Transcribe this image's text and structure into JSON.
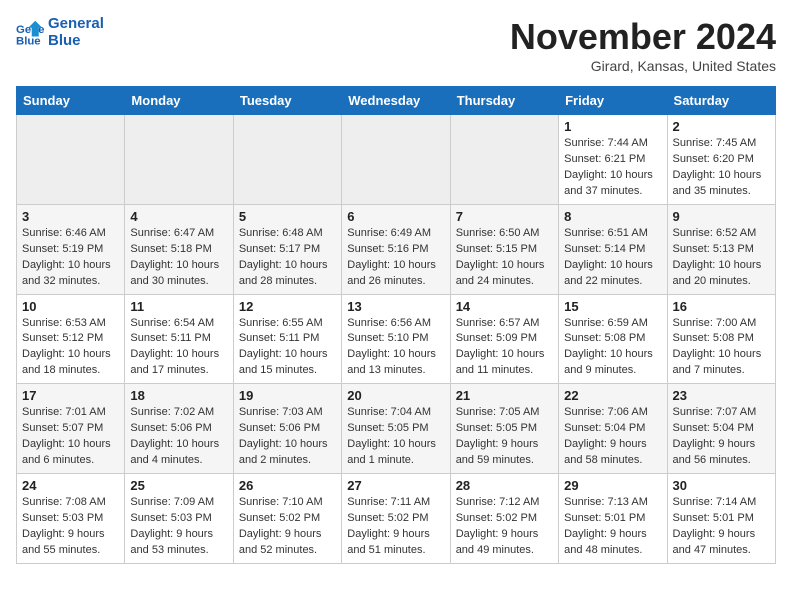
{
  "header": {
    "logo_line1": "General",
    "logo_line2": "Blue",
    "month": "November 2024",
    "location": "Girard, Kansas, United States"
  },
  "days_of_week": [
    "Sunday",
    "Monday",
    "Tuesday",
    "Wednesday",
    "Thursday",
    "Friday",
    "Saturday"
  ],
  "weeks": [
    [
      {
        "day": "",
        "empty": true
      },
      {
        "day": "",
        "empty": true
      },
      {
        "day": "",
        "empty": true
      },
      {
        "day": "",
        "empty": true
      },
      {
        "day": "",
        "empty": true
      },
      {
        "day": "1",
        "rise": "Sunrise: 7:44 AM",
        "set": "Sunset: 6:21 PM",
        "daylight": "Daylight: 10 hours and 37 minutes."
      },
      {
        "day": "2",
        "rise": "Sunrise: 7:45 AM",
        "set": "Sunset: 6:20 PM",
        "daylight": "Daylight: 10 hours and 35 minutes."
      }
    ],
    [
      {
        "day": "3",
        "rise": "Sunrise: 6:46 AM",
        "set": "Sunset: 5:19 PM",
        "daylight": "Daylight: 10 hours and 32 minutes."
      },
      {
        "day": "4",
        "rise": "Sunrise: 6:47 AM",
        "set": "Sunset: 5:18 PM",
        "daylight": "Daylight: 10 hours and 30 minutes."
      },
      {
        "day": "5",
        "rise": "Sunrise: 6:48 AM",
        "set": "Sunset: 5:17 PM",
        "daylight": "Daylight: 10 hours and 28 minutes."
      },
      {
        "day": "6",
        "rise": "Sunrise: 6:49 AM",
        "set": "Sunset: 5:16 PM",
        "daylight": "Daylight: 10 hours and 26 minutes."
      },
      {
        "day": "7",
        "rise": "Sunrise: 6:50 AM",
        "set": "Sunset: 5:15 PM",
        "daylight": "Daylight: 10 hours and 24 minutes."
      },
      {
        "day": "8",
        "rise": "Sunrise: 6:51 AM",
        "set": "Sunset: 5:14 PM",
        "daylight": "Daylight: 10 hours and 22 minutes."
      },
      {
        "day": "9",
        "rise": "Sunrise: 6:52 AM",
        "set": "Sunset: 5:13 PM",
        "daylight": "Daylight: 10 hours and 20 minutes."
      }
    ],
    [
      {
        "day": "10",
        "rise": "Sunrise: 6:53 AM",
        "set": "Sunset: 5:12 PM",
        "daylight": "Daylight: 10 hours and 18 minutes."
      },
      {
        "day": "11",
        "rise": "Sunrise: 6:54 AM",
        "set": "Sunset: 5:11 PM",
        "daylight": "Daylight: 10 hours and 17 minutes."
      },
      {
        "day": "12",
        "rise": "Sunrise: 6:55 AM",
        "set": "Sunset: 5:11 PM",
        "daylight": "Daylight: 10 hours and 15 minutes."
      },
      {
        "day": "13",
        "rise": "Sunrise: 6:56 AM",
        "set": "Sunset: 5:10 PM",
        "daylight": "Daylight: 10 hours and 13 minutes."
      },
      {
        "day": "14",
        "rise": "Sunrise: 6:57 AM",
        "set": "Sunset: 5:09 PM",
        "daylight": "Daylight: 10 hours and 11 minutes."
      },
      {
        "day": "15",
        "rise": "Sunrise: 6:59 AM",
        "set": "Sunset: 5:08 PM",
        "daylight": "Daylight: 10 hours and 9 minutes."
      },
      {
        "day": "16",
        "rise": "Sunrise: 7:00 AM",
        "set": "Sunset: 5:08 PM",
        "daylight": "Daylight: 10 hours and 7 minutes."
      }
    ],
    [
      {
        "day": "17",
        "rise": "Sunrise: 7:01 AM",
        "set": "Sunset: 5:07 PM",
        "daylight": "Daylight: 10 hours and 6 minutes."
      },
      {
        "day": "18",
        "rise": "Sunrise: 7:02 AM",
        "set": "Sunset: 5:06 PM",
        "daylight": "Daylight: 10 hours and 4 minutes."
      },
      {
        "day": "19",
        "rise": "Sunrise: 7:03 AM",
        "set": "Sunset: 5:06 PM",
        "daylight": "Daylight: 10 hours and 2 minutes."
      },
      {
        "day": "20",
        "rise": "Sunrise: 7:04 AM",
        "set": "Sunset: 5:05 PM",
        "daylight": "Daylight: 10 hours and 1 minute."
      },
      {
        "day": "21",
        "rise": "Sunrise: 7:05 AM",
        "set": "Sunset: 5:05 PM",
        "daylight": "Daylight: 9 hours and 59 minutes."
      },
      {
        "day": "22",
        "rise": "Sunrise: 7:06 AM",
        "set": "Sunset: 5:04 PM",
        "daylight": "Daylight: 9 hours and 58 minutes."
      },
      {
        "day": "23",
        "rise": "Sunrise: 7:07 AM",
        "set": "Sunset: 5:04 PM",
        "daylight": "Daylight: 9 hours and 56 minutes."
      }
    ],
    [
      {
        "day": "24",
        "rise": "Sunrise: 7:08 AM",
        "set": "Sunset: 5:03 PM",
        "daylight": "Daylight: 9 hours and 55 minutes."
      },
      {
        "day": "25",
        "rise": "Sunrise: 7:09 AM",
        "set": "Sunset: 5:03 PM",
        "daylight": "Daylight: 9 hours and 53 minutes."
      },
      {
        "day": "26",
        "rise": "Sunrise: 7:10 AM",
        "set": "Sunset: 5:02 PM",
        "daylight": "Daylight: 9 hours and 52 minutes."
      },
      {
        "day": "27",
        "rise": "Sunrise: 7:11 AM",
        "set": "Sunset: 5:02 PM",
        "daylight": "Daylight: 9 hours and 51 minutes."
      },
      {
        "day": "28",
        "rise": "Sunrise: 7:12 AM",
        "set": "Sunset: 5:02 PM",
        "daylight": "Daylight: 9 hours and 49 minutes."
      },
      {
        "day": "29",
        "rise": "Sunrise: 7:13 AM",
        "set": "Sunset: 5:01 PM",
        "daylight": "Daylight: 9 hours and 48 minutes."
      },
      {
        "day": "30",
        "rise": "Sunrise: 7:14 AM",
        "set": "Sunset: 5:01 PM",
        "daylight": "Daylight: 9 hours and 47 minutes."
      }
    ]
  ]
}
